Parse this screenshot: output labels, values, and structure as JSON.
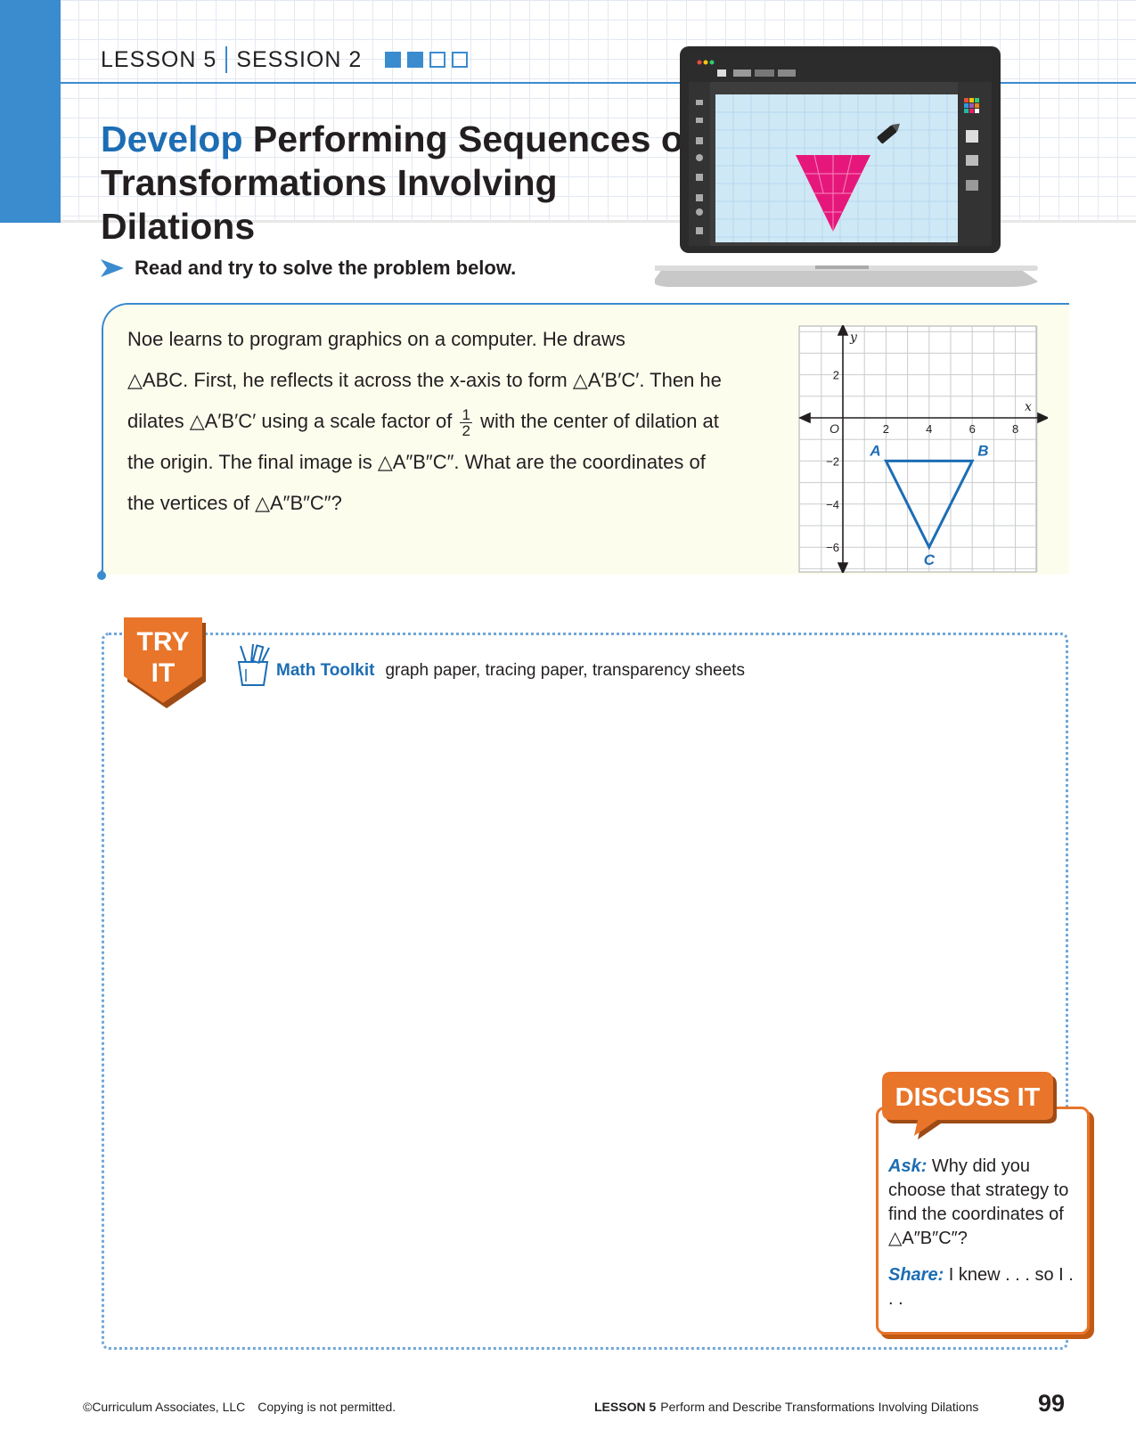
{
  "header": {
    "lesson": "LESSON 5",
    "session": "SESSION 2",
    "progress": {
      "completed": 2,
      "total": 4
    },
    "title_develop": "Develop",
    "title_line1": " Performing Sequences of",
    "title_line2": "Transformations Involving Dilations"
  },
  "instruction": "Read and try to solve the problem below.",
  "problem": {
    "line1": "Noe learns to program graphics on a computer. He draws",
    "line2": "△ABC. First, he reflects it across the x-axis to form △A′B′C′. Then he",
    "line3_pre": "dilates △A′B′C′ using a scale factor of",
    "frac_num": "1",
    "frac_den": "2",
    "line3_post": "with the center of dilation at",
    "line4": "the origin. The final image is △A″B″C″. What are the coordinates of",
    "line5": "the vertices of △A″B″C″?"
  },
  "graph": {
    "x_axis_label": "x",
    "y_axis_label": "y",
    "origin_label": "O",
    "x_ticks": [
      "2",
      "4",
      "6",
      "8"
    ],
    "y_ticks": [
      "2",
      "−2",
      "−4",
      "−6"
    ],
    "points": [
      {
        "label": "A",
        "x": 2,
        "y": -2
      },
      {
        "label": "B",
        "x": 6,
        "y": -2
      },
      {
        "label": "C",
        "x": 4,
        "y": -6
      }
    ],
    "line_color": "#1c6db4"
  },
  "try_it": {
    "badge_line1": "TRY",
    "badge_line2": "IT",
    "toolkit_label": "Math Toolkit",
    "toolkit_items": "graph paper, tracing paper, transparency sheets"
  },
  "discuss": {
    "badge": "DISCUSS IT",
    "ask_label": "Ask:",
    "ask_text": " Why did you choose that strategy to find the coordinates of △A″B″C″?",
    "share_label": "Share:",
    "share_text": " I knew . . . so I . . ."
  },
  "footer": {
    "copyright": "©Curriculum Associates, LLC",
    "notice": "Copying is not permitted.",
    "lesson_label": "LESSON 5",
    "lesson_title": "Perform and Describe Transformations Involving Dilations",
    "page": "99"
  },
  "colors": {
    "accent_blue": "#3b8bcf",
    "title_blue": "#1c6db4",
    "orange": "#e8752a",
    "triangle_pink": "#e6177b"
  }
}
